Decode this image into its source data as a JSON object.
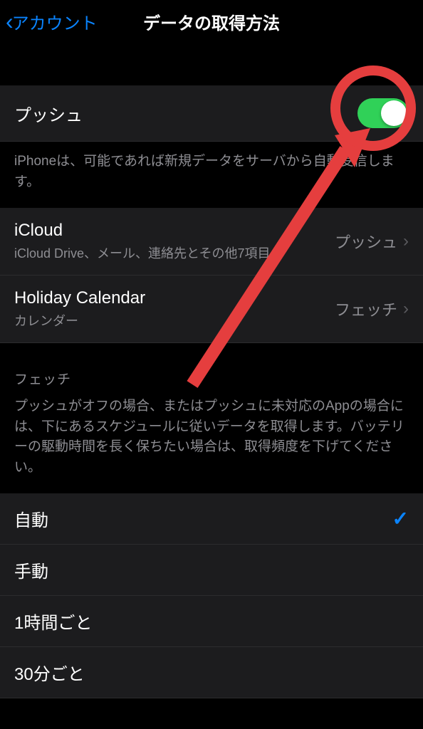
{
  "navbar": {
    "back_label": "アカウント",
    "title": "データの取得方法"
  },
  "push": {
    "label": "プッシュ",
    "description": "iPhoneは、可能であれば新規データをサーバから自動受信します。"
  },
  "accounts": [
    {
      "title": "iCloud",
      "subtitle": "iCloud Drive、メール、連絡先とその他7項目...",
      "mode": "プッシュ"
    },
    {
      "title": "Holiday Calendar",
      "subtitle": "カレンダー",
      "mode": "フェッチ"
    }
  ],
  "fetch": {
    "header": "フェッチ",
    "description": "プッシュがオフの場合、またはプッシュに未対応のAppの場合には、下にあるスケジュールに従いデータを取得します。バッテリーの駆動時間を長く保ちたい場合は、取得頻度を下げてください。",
    "options": [
      "自動",
      "手動",
      "1時間ごと",
      "30分ごと"
    ],
    "selected_index": 0
  },
  "colors": {
    "accent": "#0a84ff",
    "toggle_on": "#30d158",
    "annotation": "#e53e3e"
  }
}
